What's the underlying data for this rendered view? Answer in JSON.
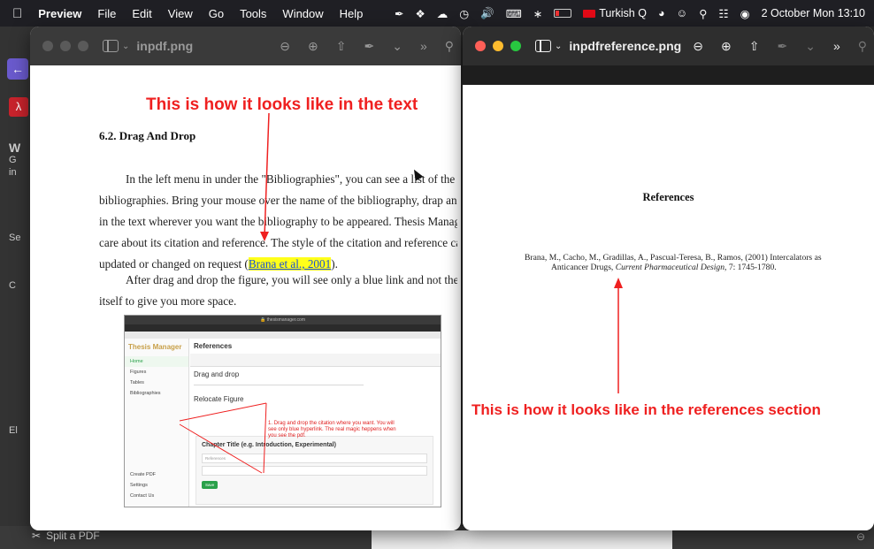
{
  "menubar": {
    "app": "Preview",
    "items": [
      "File",
      "Edit",
      "View",
      "Go",
      "Tools",
      "Window",
      "Help"
    ],
    "input_source": "Turkish Q",
    "datetime": "2 October Mon  13:10"
  },
  "background_app": {
    "letters": [
      "W",
      "G",
      "in",
      "Se",
      "C",
      "El"
    ],
    "bottom_label": "Split a PDF"
  },
  "window_left": {
    "filename": "inpdf.png",
    "note": "This is how it looks like in the text",
    "heading": "6.2. Drag And Drop",
    "paragraph1_lines": [
      "In the left menu in under the \"Bibliographies\", you can see a list of the added",
      "bibliographies. Bring your mouse over the name of the bibliography, drap and drop",
      "in the text wherever you want the bibliography to be appeared. Thesis Manager will",
      "care about its citation and reference. The style of the citation and reference can be"
    ],
    "paragraph1_last_prefix": "updated or changed on request (",
    "citation": "Brana et al., 2001",
    "paragraph1_last_suffix": ").",
    "paragraph2_lines": [
      "After drag and drop the figure, you will see only a blue link and not the figure",
      "itself to give you more space."
    ],
    "screenshot": {
      "url": "thesismanager.com",
      "brand": "Thesis Manager",
      "header": "References",
      "sidebar": [
        "Home",
        "Figures",
        "Tables",
        "Bibliographies",
        "Create PDF",
        "Settings",
        "Contact Us"
      ],
      "section": "Drag and drop",
      "relocate": "Relocate Figure",
      "chapter": "Chapter Title (e.g. Introduction, Experimental)",
      "references_placeholder": "References",
      "save": "Save",
      "annotation": "1. Drag and drop the citation where you want. You will see only blue hyperlink. The real magic heppens when you see the pdf."
    }
  },
  "window_right": {
    "filename": "inpdfreference.png",
    "ref_title": "References",
    "ref_line1": "Brana, M., Cacho, M., Gradillas, A., Pascual-Teresa, B., Ramos, (2001) Intercalators as",
    "ref_line2_prefix": "Anticancer Drugs, ",
    "ref_journal": "Current Pharmaceutical Design",
    "ref_line2_suffix": ", 7: 1745-1780.",
    "note": "This is how it looks like in the references section"
  },
  "colors": {
    "note_red": "#ef2020",
    "highlight": "#ffff1a",
    "link_blue": "#1a4fd6"
  }
}
